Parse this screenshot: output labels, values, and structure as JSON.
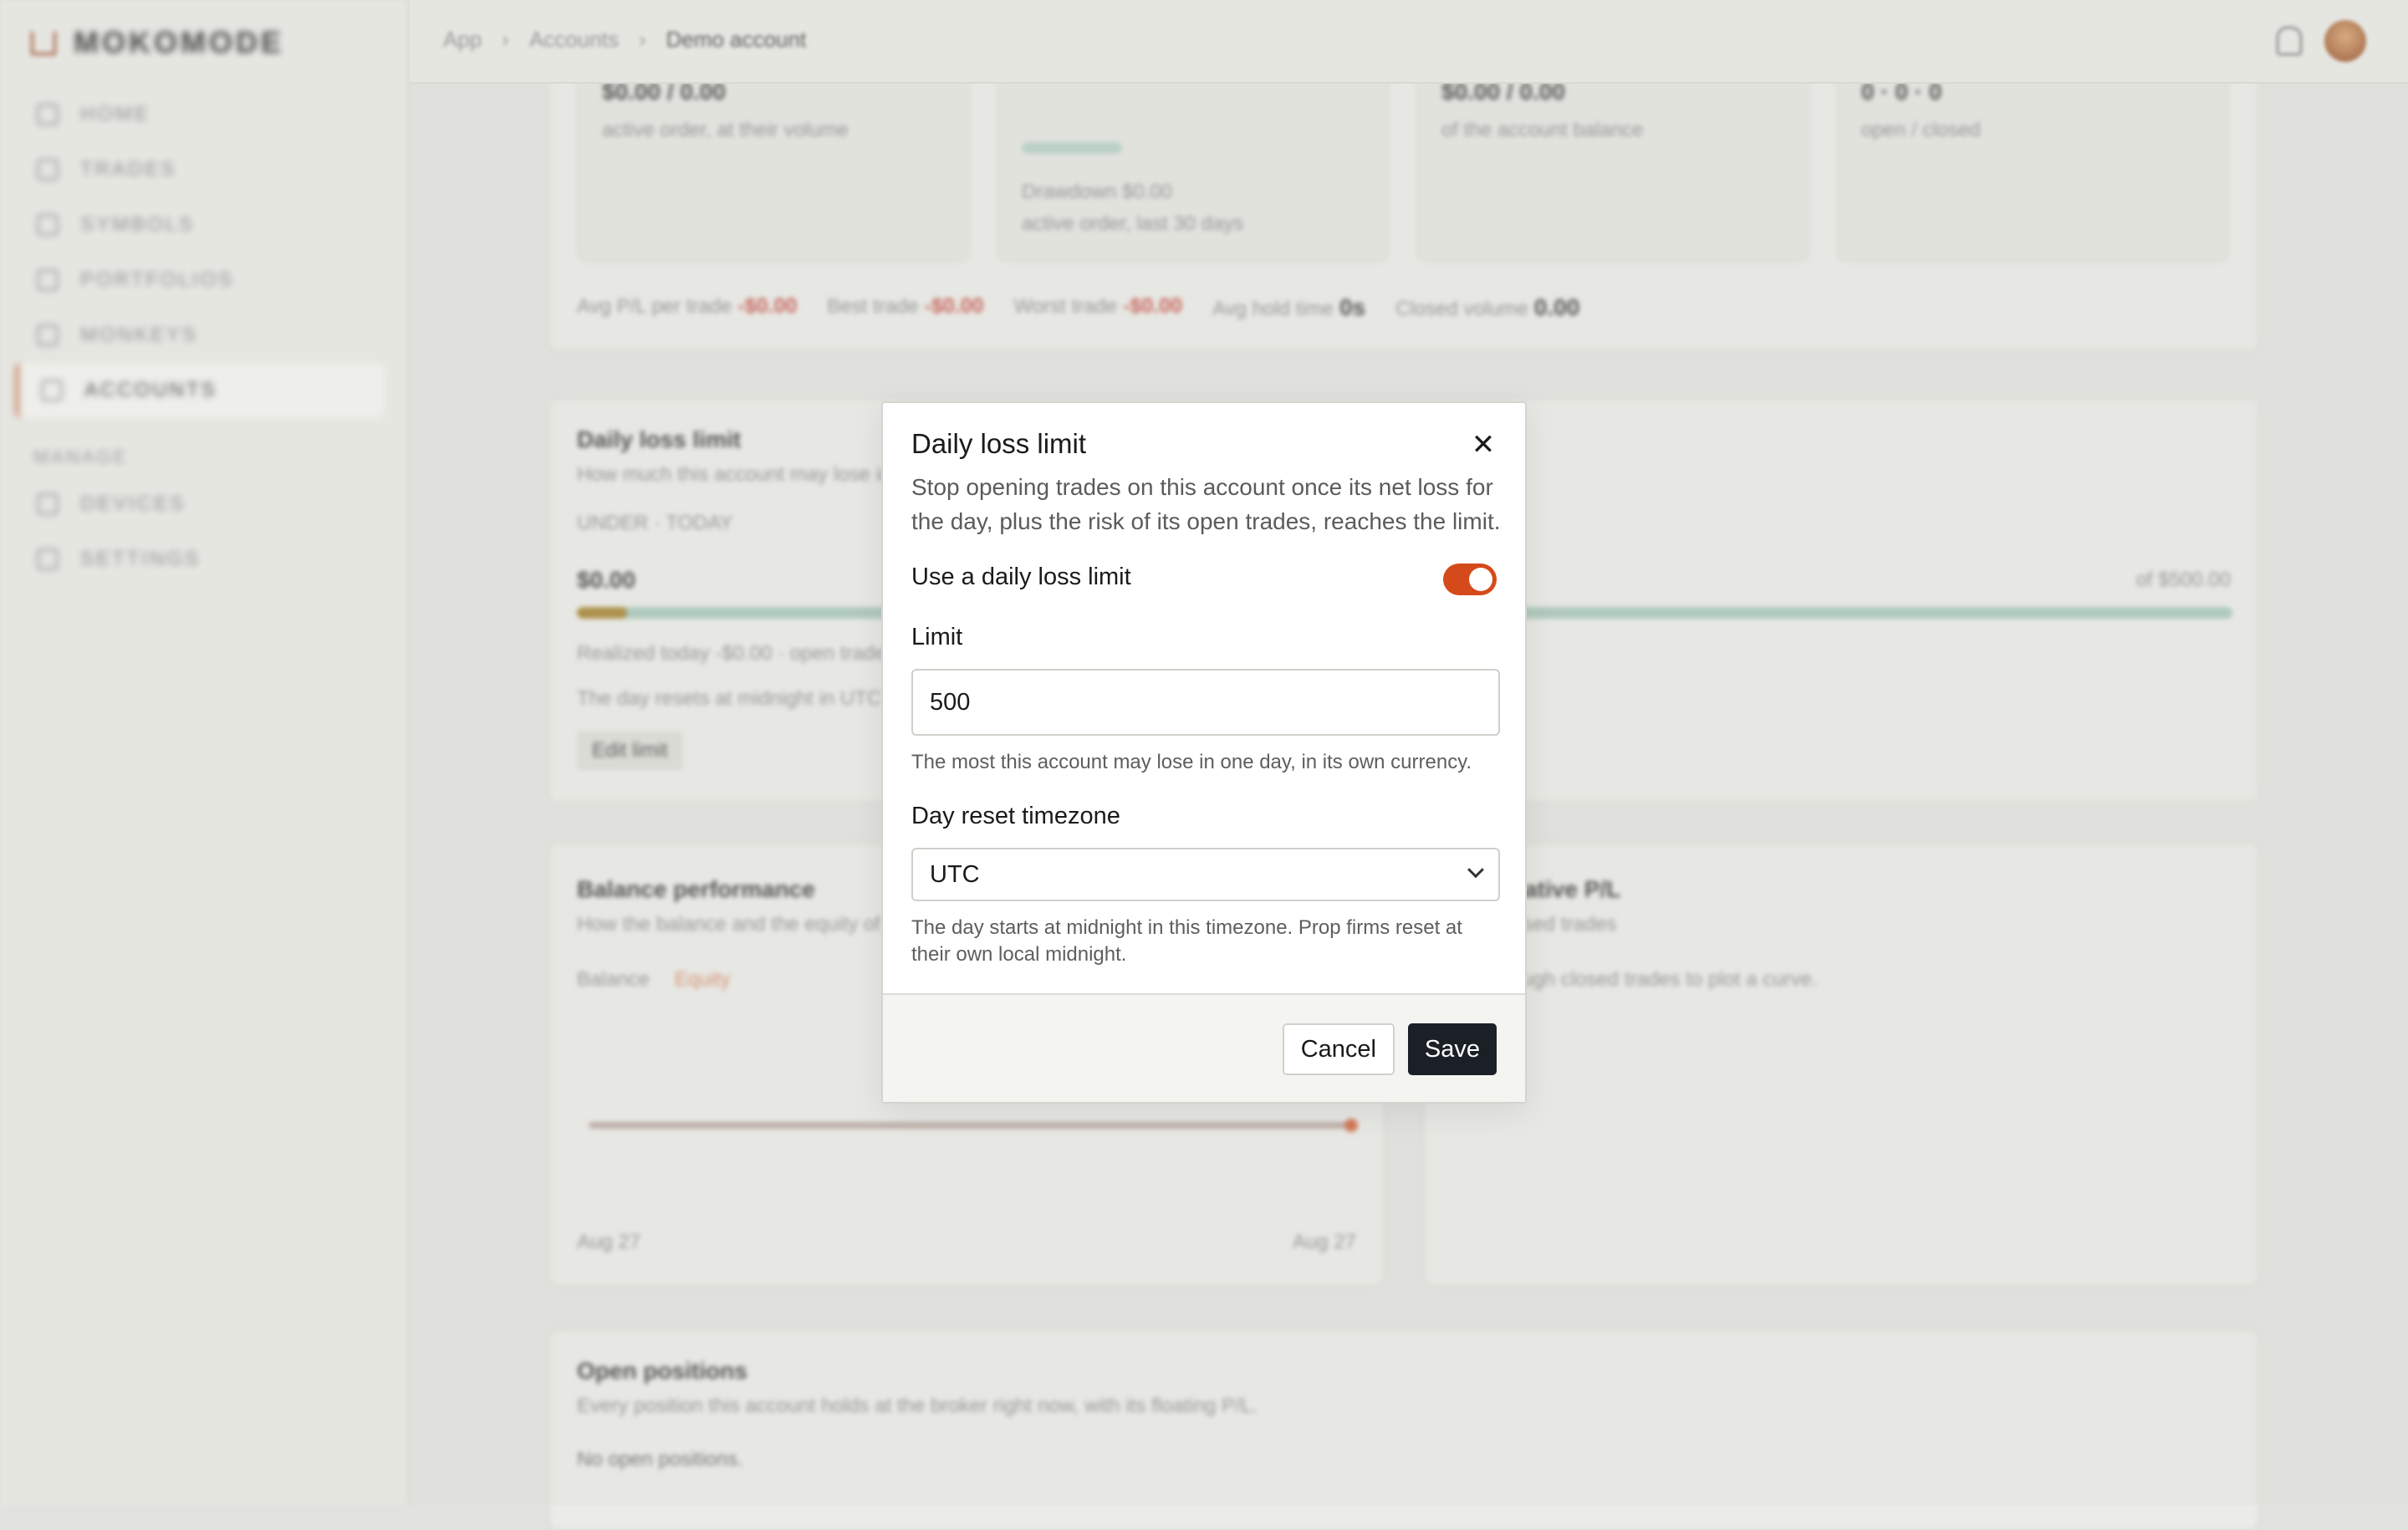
{
  "brand": {
    "name": "MOKOMODE"
  },
  "sidebar": {
    "items": [
      {
        "label": "HOME"
      },
      {
        "label": "TRADES"
      },
      {
        "label": "SYMBOLS"
      },
      {
        "label": "PORTFOLIOS"
      },
      {
        "label": "MONKEYS"
      },
      {
        "label": "ACCOUNTS"
      }
    ],
    "section": "MANAGE",
    "manage_items": [
      {
        "label": "DEVICES"
      },
      {
        "label": "SETTINGS"
      }
    ]
  },
  "breadcrumb": {
    "root": "App",
    "parent": "Accounts",
    "current": "Demo account",
    "sep": "›"
  },
  "background": {
    "stats": [
      {
        "value": "$0.00 / 0.00",
        "sub": "active order, at their volume"
      },
      {
        "value": "$0.00 / 0.00",
        "sub": "of the account balance"
      },
      {
        "value": "0 · 0 · 0",
        "sub": "open / closed"
      }
    ],
    "drawdown": "Drawdown $0.00",
    "drawdown_sub": "active order, last 30 days",
    "summary": [
      {
        "label": "Avg P/L per trade",
        "value": "-$0.00"
      },
      {
        "label": "Best trade",
        "value": "-$0.00"
      },
      {
        "label": "Worst trade",
        "value": "-$0.00"
      },
      {
        "label": "Avg hold time",
        "value": "0s"
      },
      {
        "label": "Closed volume",
        "value": "0.00"
      }
    ],
    "dll_title": "Daily loss limit",
    "dll_sub": "How much this account may lose in one day",
    "dll_tags": "UNDER · TODAY",
    "dll_amount": "$0.00",
    "dll_of": "of $500.00",
    "dll_realized": "Realized today -$0.00 · open trades",
    "dll_reset": "The day resets at midnight in UTC",
    "dll_edit": "Edit limit",
    "perf_title": "Balance performance",
    "perf_sub": "How the balance and the equity of this account",
    "legend_balance": "Balance",
    "legend_equity": "Equity",
    "date_start": "Aug 27",
    "date_end": "Aug 27",
    "cum_title": "Cumulative P/L",
    "cum_sub": "from closed trades",
    "cum_empty": "Not enough closed trades to plot a curve.",
    "open_title": "Open positions",
    "open_sub": "Every position this account holds at the broker right now, with its floating P/L.",
    "open_empty": "No open positions."
  },
  "modal": {
    "title": "Daily loss limit",
    "close_glyph": "✕",
    "description": "Stop opening trades on this account once its net loss for the day, plus the risk of its open trades, reaches the limit.",
    "toggle_label": "Use a daily loss limit",
    "toggle_on": true,
    "limit_label": "Limit",
    "limit_value": "500",
    "limit_help": "The most this account may lose in one day, in its own currency.",
    "tz_label": "Day reset timezone",
    "tz_value": "UTC",
    "tz_help": "The day starts at midnight in this timezone. Prop firms reset at their own local midnight.",
    "cancel_label": "Cancel",
    "save_label": "Save"
  },
  "colors": {
    "accent": "#d54a1a",
    "primary_button": "#1b1f26",
    "background": "#e2e2de"
  }
}
